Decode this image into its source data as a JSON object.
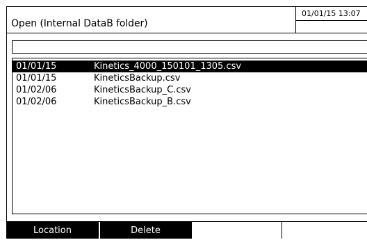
{
  "header": {
    "title": "Open (Internal DataB folder)",
    "datetime": "01/01/15 13:07"
  },
  "path_field": {
    "value": ""
  },
  "files": [
    {
      "date": "01/01/15",
      "name": "Kinetics_4000_150101_1305.csv",
      "selected": true
    },
    {
      "date": "01/01/15",
      "name": "KineticsBackup.csv",
      "selected": false
    },
    {
      "date": "01/02/06",
      "name": "KineticsBackup_C.csv",
      "selected": false
    },
    {
      "date": "01/02/06",
      "name": "KineticsBackup_B.csv",
      "selected": false
    }
  ],
  "softkeys": {
    "location_label": "Location",
    "delete_label": "Delete",
    "key3_label": "",
    "key4_label": ""
  }
}
